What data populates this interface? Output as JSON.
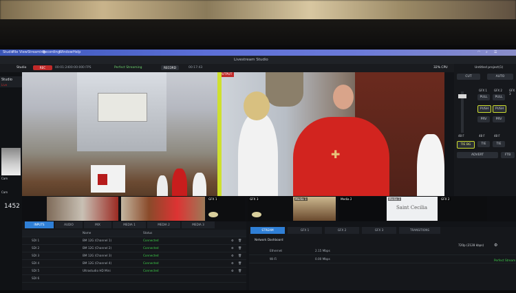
{
  "menubar": {
    "items": [
      "Studio",
      "File",
      "View",
      "Streaming",
      "Recording",
      "Window",
      "Help"
    ]
  },
  "app": {
    "title": "Livestream Studio"
  },
  "toolbar": {
    "studio": "Studio",
    "rec_badge": "REC",
    "time1": "00:01:24",
    "time2": "00:00:00",
    "fps": "0 FPS",
    "status": "Perfect Streaming",
    "record_btn": "RECORD",
    "record_time": "00:17:43",
    "cpu": "32% CPU",
    "project": "Untitled project(1)"
  },
  "program": {
    "label": "OUTPUT"
  },
  "right_panel": {
    "cut": "CUT",
    "auto": "AUTO",
    "gfx1": "GFX 1",
    "gfx2": "GFX 2",
    "gfx3": "GFX 3",
    "pull": "PULL",
    "push": "PUSH",
    "prv": "PRV",
    "f1": "48 F",
    "f2": "48 F",
    "f3": "48 F",
    "tie_bg": "TIE BG",
    "tie": "TIE",
    "advert": "ADVERT",
    "ftb": "FTB"
  },
  "left_strip": {
    "studio": "Studio",
    "live": "Live",
    "label1": "Cam",
    "label2": "Cam",
    "count": "1452"
  },
  "thumbnails": [
    {
      "label": ""
    },
    {
      "label": ""
    },
    {
      "label": "GFX 1"
    },
    {
      "label": "GFX 3"
    },
    {
      "label": "Media 1"
    },
    {
      "label": "Media 2"
    },
    {
      "label": "Media 3"
    },
    {
      "label": "GFX 2"
    }
  ],
  "media3_title": "Saint Cecilia",
  "bottom_left": {
    "tabs": [
      "INPUTS",
      "AUDIO",
      "MIX",
      "MEDIA 1",
      "MEDIA 2",
      "MEDIA 3"
    ],
    "header": [
      "Name",
      "Status"
    ],
    "rows": [
      {
        "name": "SDI 1",
        "device": "BM 12G (Channel 1)",
        "status": "Connected"
      },
      {
        "name": "SDI 2",
        "device": "BM 12G (Channel 2)",
        "status": "Connected"
      },
      {
        "name": "SDI 3",
        "device": "BM 12G (Channel 3)",
        "status": "Connected"
      },
      {
        "name": "SDI 4",
        "device": "BM 12G (Channel 4)",
        "status": "Connected"
      },
      {
        "name": "SDI 5",
        "device": "Ultrastudio HD Mini",
        "status": "Connected"
      },
      {
        "name": "SDI 6",
        "device": "",
        "status": ""
      }
    ]
  },
  "bottom_right": {
    "tabs": [
      "STREAM",
      "GFX 1",
      "GFX 2",
      "GFX 3",
      "TRANSITIONS"
    ],
    "section": "Network Dashboard",
    "rows": [
      {
        "name": "Ethernet",
        "value": "2.15 Mbps"
      },
      {
        "name": "Wi-Fi",
        "value": "0.00 Mbps"
      }
    ],
    "quality": "720p (2128 kbps)",
    "status": "Perfect Stream"
  }
}
